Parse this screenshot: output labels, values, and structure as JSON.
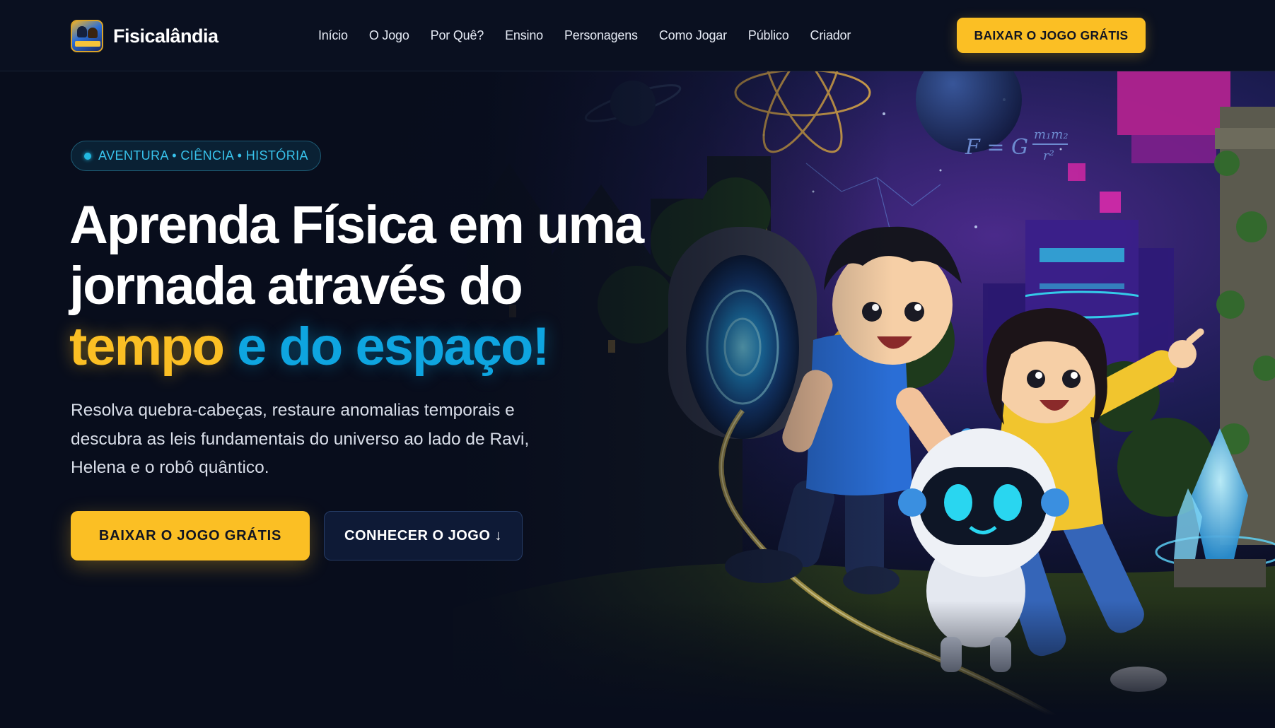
{
  "brand": {
    "name": "Fisicalândia",
    "logo_icon": "game-logo-icon"
  },
  "nav": {
    "items": [
      {
        "label": "Início"
      },
      {
        "label": "O Jogo"
      },
      {
        "label": "Por Quê?"
      },
      {
        "label": "Ensino"
      },
      {
        "label": "Personagens"
      },
      {
        "label": "Como Jogar"
      },
      {
        "label": "Público"
      },
      {
        "label": "Criador"
      }
    ],
    "cta_label": "BAIXAR O JOGO GRÁTIS"
  },
  "hero": {
    "badge": "AVENTURA • CIÊNCIA • HISTÓRIA",
    "headline": {
      "line1": "Aprenda Física em uma",
      "line2": "jornada através do",
      "highlight_time": "tempo",
      "highlight_space": "e do espaço!"
    },
    "subtitle": "Resolva quebra-cabeças, restaure anomalias temporais e descubra as leis fundamentais do universo ao lado de Ravi, Helena e o robô quântico.",
    "primary_cta": "BAIXAR O JOGO GRÁTIS",
    "secondary_cta": "CONHECER O JOGO ↓",
    "illustration_formula": "F = G m₁m₂ / r²"
  },
  "colors": {
    "background": "#080d1c",
    "accent_yellow": "#fbbf24",
    "accent_blue": "#0ea5e0",
    "badge_text": "#38c3ec"
  }
}
